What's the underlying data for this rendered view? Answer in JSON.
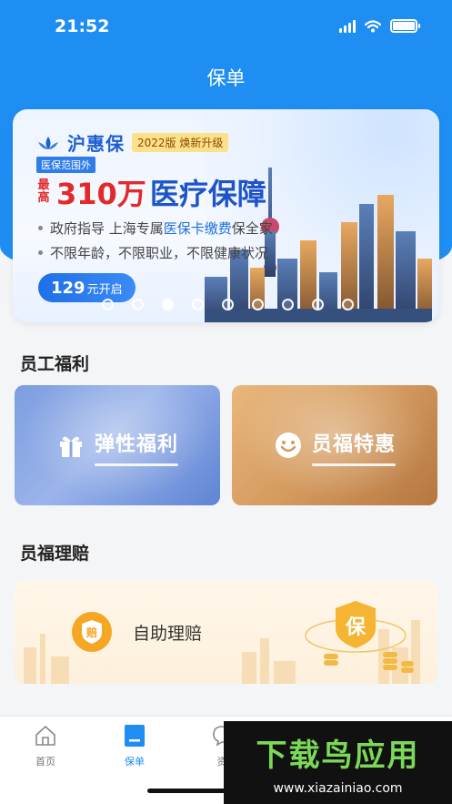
{
  "status_bar": {
    "time": "21:52"
  },
  "header": {
    "title": "保单"
  },
  "banner": {
    "brand": "沪惠保",
    "version_badge": "2022版 焕新升级",
    "coverage_scope": "医保范围外",
    "headline_prefix": "最高",
    "headline_amount": "310万",
    "headline_rest": "医疗保障",
    "bullet_1_pre": "政府指导 上海专属 ",
    "bullet_1_highlight": "医保卡缴费",
    "bullet_1_post": "保全家",
    "bullet_2": "不限年龄，不限职业，不限健康状况",
    "cta_price": "129",
    "cta_suffix": "元开启",
    "active_slide": 3,
    "slide_count": 9
  },
  "welfare": {
    "title": "员工福利",
    "cards": [
      {
        "label": "弹性福利",
        "icon": "gift-icon"
      },
      {
        "label": "员福特惠",
        "icon": "smile-icon"
      }
    ]
  },
  "claims": {
    "title": "员福理赔",
    "card_label": "自助理赔",
    "icon_text": "赔",
    "art_text": "保"
  },
  "tabs": [
    {
      "label": "首页",
      "icon": "home-icon",
      "active": false
    },
    {
      "label": "保单",
      "icon": "policy-icon",
      "active": true
    },
    {
      "label": "资",
      "icon": "chat-icon",
      "active": false
    }
  ],
  "watermark": {
    "title": "下载鸟应用",
    "url": "www.xiazainiao.com"
  },
  "colors": {
    "primary": "#1f8ef3",
    "accent_red": "#e32a2a",
    "brand_blue": "#1d55c9"
  }
}
